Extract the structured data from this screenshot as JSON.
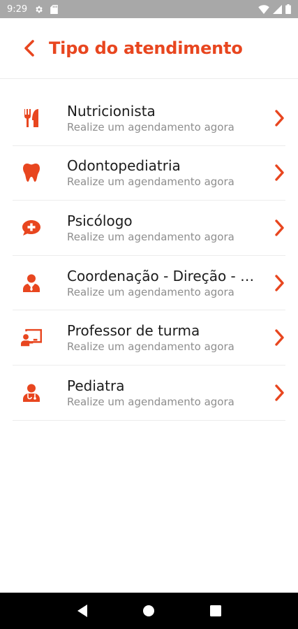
{
  "status_bar": {
    "time": "9:29",
    "icons": [
      "gear-icon",
      "sd-card-icon",
      "wifi-icon",
      "signal-icon",
      "battery-icon"
    ]
  },
  "header": {
    "title": "Tipo do atendimento",
    "back_icon": "chevron-left-icon"
  },
  "colors": {
    "accent": "#e8461f",
    "status_bar": "#a8a8a8",
    "nav_bar": "#000000",
    "subtitle": "#8e8e8e",
    "divider": "#ececec"
  },
  "items": [
    {
      "title": "Nutricionista",
      "subtitle": "Realize um agendamento agora",
      "icon": "utensils-icon"
    },
    {
      "title": "Odontopediatria",
      "subtitle": "Realize um agendamento agora",
      "icon": "tooth-icon"
    },
    {
      "title": "Psicólogo",
      "subtitle": "Realize um agendamento agora",
      "icon": "comment-medical-icon"
    },
    {
      "title": "Coordenação - Direção - Secretaria",
      "subtitle": "Realize um agendamento agora",
      "icon": "user-tie-icon"
    },
    {
      "title": "Professor de turma",
      "subtitle": "Realize um agendamento agora",
      "icon": "chalkboard-teacher-icon"
    },
    {
      "title": "Pediatra",
      "subtitle": "Realize um agendamento agora",
      "icon": "user-doctor-icon"
    }
  ],
  "nav_bar": {
    "buttons": [
      "back-triangle-icon",
      "home-circle-icon",
      "recents-square-icon"
    ]
  }
}
